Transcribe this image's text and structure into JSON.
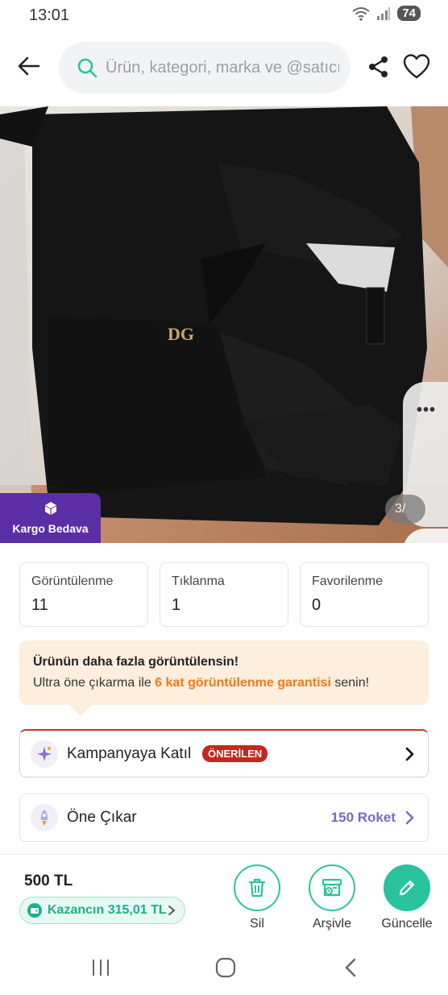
{
  "status_bar": {
    "time": "13:01",
    "battery": "74"
  },
  "search": {
    "placeholder": "Ürün, kategori, marka ve @satıcı ara"
  },
  "product": {
    "cargo_badge": "Kargo Bedava",
    "page_indicator": "3/",
    "logo_text": "DG"
  },
  "stats": [
    {
      "label": "Görüntülenme",
      "value": "11"
    },
    {
      "label": "Tıklanma",
      "value": "1"
    },
    {
      "label": "Favorilenme",
      "value": "0"
    }
  ],
  "promo": {
    "title": "Ürünün daha fazla görüntülensin!",
    "text_before": "Ultra öne çıkarma ile ",
    "highlight": "6 kat görüntülenme garantisi",
    "text_after": " senin!"
  },
  "campaign": {
    "title": "Kampanyaya Katıl",
    "badge": "ÖNERİLEN"
  },
  "boost": {
    "title": "Öne Çıkar",
    "right_text": "150 Roket"
  },
  "bottom": {
    "price": "500 TL",
    "earning": "Kazancın 315,01 TL",
    "actions": {
      "delete": "Sil",
      "archive": "Arşivle",
      "update": "Güncelle"
    }
  },
  "colors": {
    "accent_green": "#29c49c",
    "badge_purple": "#5b2ea6",
    "promo_orange": "#f07a1a",
    "recommended_red": "#c6261f",
    "rocket_purple": "#7b68c6"
  }
}
